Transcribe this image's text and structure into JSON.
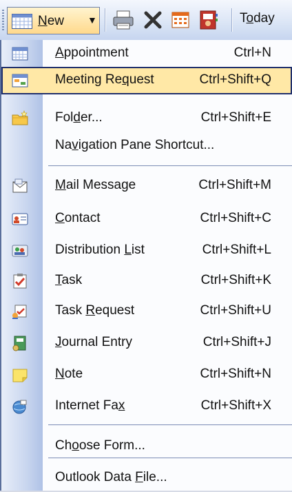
{
  "toolbar": {
    "new_button": {
      "label": "New",
      "access_key": "N",
      "icon": "calendar-grid-icon"
    },
    "buttons": [
      {
        "name": "print-icon"
      },
      {
        "name": "delete-icon"
      },
      {
        "name": "calendar-icon"
      },
      {
        "name": "address-book-icon"
      }
    ],
    "today": {
      "prefix": "T",
      "key": "o",
      "suffix": "day"
    }
  },
  "menu": {
    "items": [
      {
        "pre": "",
        "key": "A",
        "post": "ppointment",
        "shortcut": "Ctrl+N",
        "icon": "appointment-icon"
      },
      {
        "pre": "Meeting Re",
        "key": "q",
        "post": "uest",
        "shortcut": "Ctrl+Shift+Q",
        "icon": "meeting-request-icon",
        "highlighted": true
      },
      {
        "pre": "Fol",
        "key": "d",
        "post": "er...",
        "shortcut": "Ctrl+Shift+E",
        "icon": "folder-icon"
      },
      {
        "pre": "Na",
        "key": "v",
        "post": "igation Pane Shortcut...",
        "shortcut": "",
        "icon": ""
      },
      {
        "pre": "",
        "key": "M",
        "post": "ail Message",
        "shortcut": "Ctrl+Shift+M",
        "icon": "mail-message-icon"
      },
      {
        "pre": "",
        "key": "C",
        "post": "ontact",
        "shortcut": "Ctrl+Shift+C",
        "icon": "contact-icon"
      },
      {
        "pre": "Distribution ",
        "key": "L",
        "post": "ist",
        "shortcut": "Ctrl+Shift+L",
        "icon": "distribution-list-icon"
      },
      {
        "pre": "",
        "key": "T",
        "post": "ask",
        "shortcut": "Ctrl+Shift+K",
        "icon": "task-icon"
      },
      {
        "pre": "Task ",
        "key": "R",
        "post": "equest",
        "shortcut": "Ctrl+Shift+U",
        "icon": "task-request-icon"
      },
      {
        "pre": "",
        "key": "J",
        "post": "ournal Entry",
        "shortcut": "Ctrl+Shift+J",
        "icon": "journal-entry-icon"
      },
      {
        "pre": "",
        "key": "N",
        "post": "ote",
        "shortcut": "Ctrl+Shift+N",
        "icon": "note-icon"
      },
      {
        "pre": "Internet Fa",
        "key": "x",
        "post": "",
        "shortcut": "Ctrl+Shift+X",
        "icon": "internet-fax-icon"
      },
      {
        "pre": "Ch",
        "key": "o",
        "post": "ose Form...",
        "shortcut": "",
        "icon": ""
      },
      {
        "pre": "Outlook Data ",
        "key": "F",
        "post": "ile...",
        "shortcut": "",
        "icon": ""
      }
    ]
  },
  "colors": {
    "highlight_bg": "#ffe8a6",
    "highlight_border": "#1f2f6c",
    "menu_bg": "#fbfcfe",
    "gutter": "#c9d6ef"
  }
}
